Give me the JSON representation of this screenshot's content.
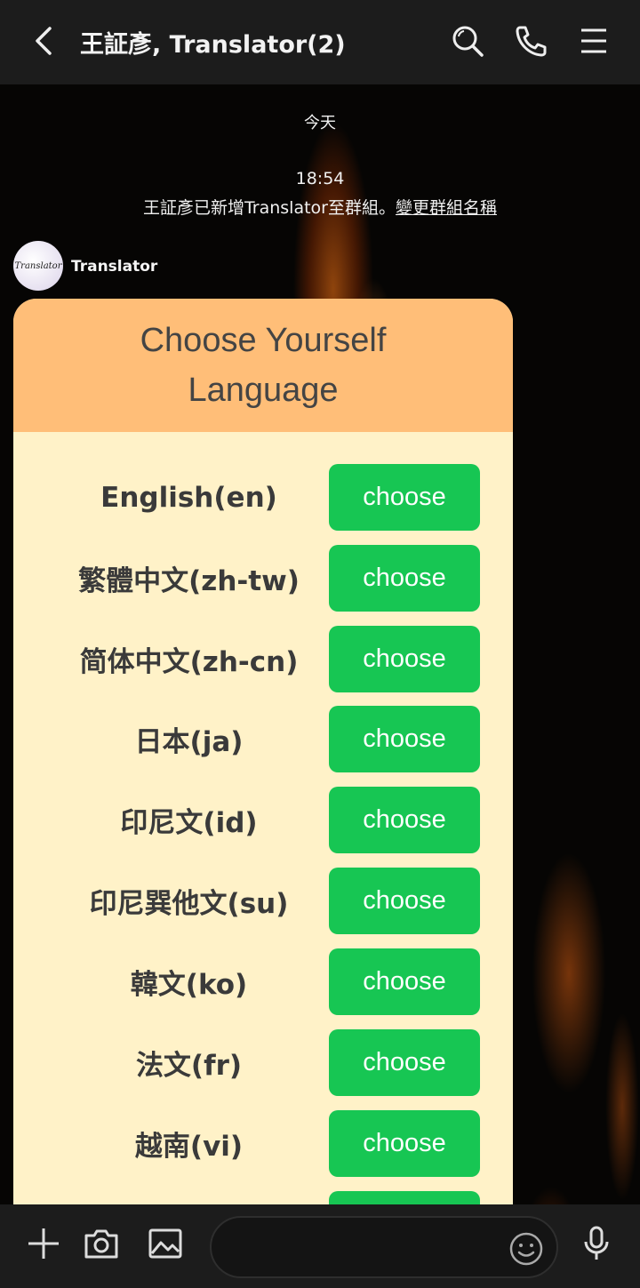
{
  "header": {
    "title": "王証彥, Translator(2)",
    "icons": [
      "back-icon",
      "search-icon",
      "phone-icon",
      "menu-icon"
    ]
  },
  "chat": {
    "date_divider": "今天",
    "system_time": "18:54",
    "system_message": "王証彥已新增Translator至群組。",
    "system_link": "變更群組名稱",
    "sender_name": "Translator",
    "avatar_text": "Translator"
  },
  "card": {
    "title": "Choose Yourself Language",
    "languages": [
      {
        "label": "English(en)",
        "button": "choose"
      },
      {
        "label": "繁體中文(zh-tw)",
        "button": "choose"
      },
      {
        "label": "简体中文(zh-cn)",
        "button": "choose"
      },
      {
        "label": "日本(ja)",
        "button": "choose"
      },
      {
        "label": "印尼文(id)",
        "button": "choose"
      },
      {
        "label": "印尼巽他文(su)",
        "button": "choose"
      },
      {
        "label": "韓文(ko)",
        "button": "choose"
      },
      {
        "label": "法文(fr)",
        "button": "choose"
      },
      {
        "label": "越南(vi)",
        "button": "choose"
      }
    ]
  },
  "input_bar": {
    "icons": [
      "plus-icon",
      "camera-icon",
      "image-icon",
      "emoji-icon",
      "microphone-icon"
    ],
    "placeholder": ""
  },
  "colors": {
    "header_bg": "#1c1c1c",
    "card_header": "#ffbe78",
    "card_body": "#fff2c8",
    "button_green": "#17c653"
  }
}
